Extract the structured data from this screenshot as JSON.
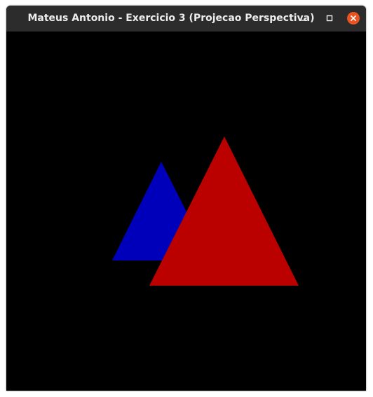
{
  "window": {
    "title": "Mateus Antonio - Exercicio 3 (Projecao Perspectiva)",
    "controls": {
      "minimize_icon": "minimize-icon",
      "maximize_icon": "maximize-icon",
      "close_icon": "close-icon",
      "close_color": "#e95420"
    }
  },
  "scene": {
    "background": "#000000",
    "shapes": [
      {
        "name": "blue-triangle",
        "kind": "triangle",
        "color": "#0000bb"
      },
      {
        "name": "red-triangle",
        "kind": "triangle",
        "color": "#bb0000"
      }
    ]
  }
}
